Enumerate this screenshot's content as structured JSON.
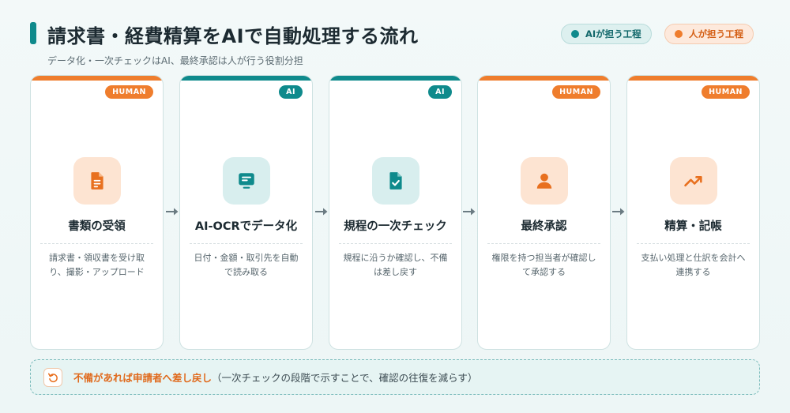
{
  "header": {
    "title": "請求書・経費精算をAIで自動処理する流れ",
    "subtitle": "データ化・一次チェックはAI、最終承認は人が行う役割分担"
  },
  "legend": {
    "ai": "AIが担う工程",
    "human": "人が担う工程"
  },
  "steps": [
    {
      "badge": "HUMAN",
      "icon": "document-icon",
      "title": "書類の受領",
      "desc": "請求書・領収書を受け取り、撮影・アップロード"
    },
    {
      "badge": "AI",
      "icon": "scan-text-icon",
      "title": "AI-OCRでデータ化",
      "desc": "日付・金額・取引先を自動で読み取る"
    },
    {
      "badge": "AI",
      "icon": "file-check-icon",
      "title": "規程の一次チェック",
      "desc": "規程に沿うか確認し、不備は差し戻す"
    },
    {
      "badge": "HUMAN",
      "icon": "person-icon",
      "title": "最終承認",
      "desc": "権限を持つ担当者が確認して承認する"
    },
    {
      "badge": "HUMAN",
      "icon": "trending-up-icon",
      "title": "精算・記帳",
      "desc": "支払い処理と仕訳を会計へ連携する"
    }
  ],
  "note": {
    "strong": "不備があれば申請者へ差し戻し",
    "text": "（一次チェックの段階で示すことで、確認の往復を減らす）"
  },
  "colors": {
    "ai": "#0f8a8c",
    "human": "#ef7d2d"
  }
}
